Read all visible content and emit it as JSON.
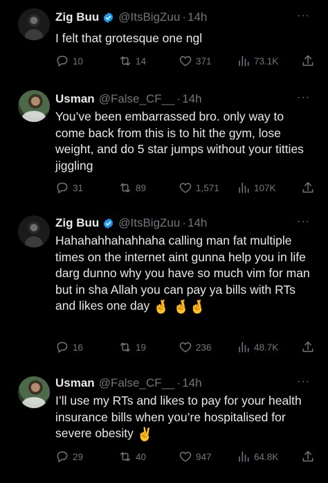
{
  "colors": {
    "background": "#000000",
    "text": "#e7e9ea",
    "muted": "#71767b",
    "verified": "#1d9bf0"
  },
  "tweets": [
    {
      "name": "Zig Buu",
      "verified": true,
      "handle": "@ItsBigZuu",
      "time": "14h",
      "avatar": "zig",
      "text": "I felt that grotesque one ngl",
      "emoji": "",
      "replies": "10",
      "retweets": "14",
      "likes": "371",
      "views": "73.1K"
    },
    {
      "name": "Usman",
      "verified": false,
      "handle": "@False_CF__",
      "time": "14h",
      "avatar": "usman",
      "text": "You’ve been embarrassed bro. only way to come back from this is to hit the gym, lose weight, and do 5 star jumps without your titties jiggling",
      "emoji": "",
      "replies": "31",
      "retweets": "89",
      "likes": "1,571",
      "views": "107K"
    },
    {
      "name": "Zig Buu",
      "verified": true,
      "handle": "@ItsBigZuu",
      "time": "14h",
      "avatar": "zig",
      "text": "Hahahahhahahhaha calling man fat multiple times on the internet aint gunna help you in life darg dunno why you have so much vim for man but in sha Allah you can pay ya bills with RTs and likes one day",
      "emoji": "🤞 🤞🤞",
      "replies": "16",
      "retweets": "19",
      "likes": "236",
      "views": "48.7K"
    },
    {
      "name": "Usman",
      "verified": false,
      "handle": "@False_CF__",
      "time": "14h",
      "avatar": "usman",
      "text": "I’ll use my RTs and likes to pay for your health insurance bills when you’re hospitalised for severe obesity",
      "emoji": "✌️",
      "replies": "29",
      "retweets": "40",
      "likes": "947",
      "views": "64.8K"
    }
  ],
  "icons": {
    "reply": "reply-icon",
    "retweet": "retweet-icon",
    "like": "heart-icon",
    "views": "views-icon",
    "share": "share-icon",
    "more": "more-icon",
    "verified": "verified-badge-icon"
  },
  "separator": "·",
  "more_label": "···"
}
